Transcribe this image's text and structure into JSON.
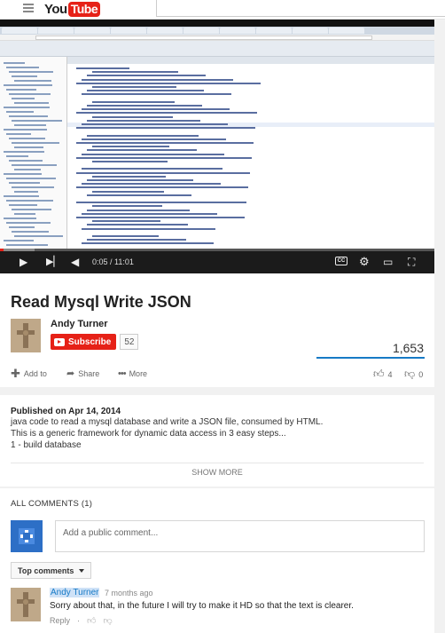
{
  "masthead": {
    "logo_you": "You",
    "logo_tube": "Tube"
  },
  "player": {
    "time_current": "0:05",
    "time_total": "11:01",
    "time_display": "0:05 / 11:01",
    "progress_fraction": 0.0076,
    "buffer_fraction": 0.08,
    "cc_label": "CC",
    "icons": [
      "play-icon",
      "next-icon",
      "volume-icon",
      "captions-icon",
      "settings-icon",
      "theater-icon",
      "fullscreen-icon"
    ]
  },
  "video": {
    "title": "Read Mysql Write JSON",
    "channel": "Andy Turner",
    "subscribe_label": "Subscribe",
    "subscriber_count": "52",
    "views": "1,653",
    "like_ratio": 1.0,
    "actions": {
      "add_to": "Add to",
      "share": "Share",
      "more": "More"
    },
    "likes": "4",
    "dislikes": "0"
  },
  "description": {
    "published": "Published on Apr 14, 2014",
    "lines": [
      "java code to read a mysql database and write a JSON file, consumed by HTML.",
      "This is a generic framework for dynamic data access in 3 easy steps...",
      "1 - build database"
    ],
    "show_more": "SHOW MORE"
  },
  "comments": {
    "header": "ALL COMMENTS (1)",
    "placeholder": "Add a public comment...",
    "sort_label": "Top comments",
    "items": [
      {
        "author": "Andy Turner",
        "time": "7 months ago",
        "text": "Sorry about that, in the future I will try to make it HD so that the text is clearer.",
        "reply": "Reply",
        "separator": "·"
      }
    ]
  },
  "colors": {
    "brand_red": "#e62117",
    "link_blue": "#167ac6",
    "player_bg": "#1b1b1b"
  }
}
